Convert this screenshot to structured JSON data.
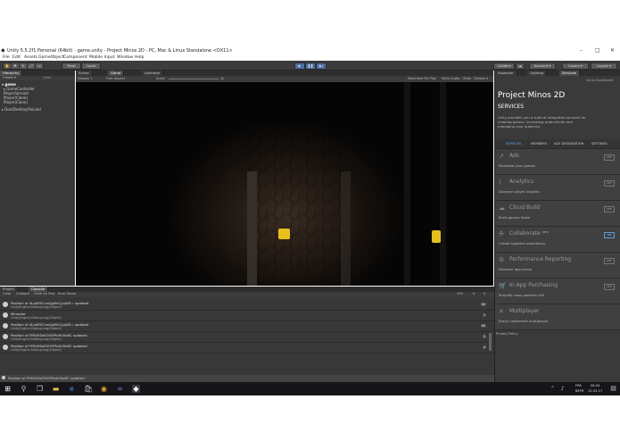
{
  "window": {
    "title": "Unity 5.5.2f1 Personal (64bit) - game.unity - Project Minos 2D - PC, Mac & Linux Standalone <DX11>",
    "minimize": "–",
    "maximize": "□",
    "close": "✕"
  },
  "menu": [
    "File",
    "Edit",
    "Assets",
    "GameObject",
    "Component",
    "Mobile Input",
    "Window",
    "Help"
  ],
  "toolbar": {
    "pivot": "Pivot",
    "local": "Local",
    "collab": "Collab ▾",
    "account": "Account ▾",
    "layers": "Layers ▾",
    "layout": "Layout ▾"
  },
  "hierarchy": {
    "tab": "Hierarchy",
    "create": "Create ▾",
    "search_placeholder": "Q▾All",
    "items": [
      "▾ game",
      "  ▸ GameController",
      "    PlayerServant",
      "    Player(Clone)",
      "    Player(Clone)",
      "▸ DontDestroyOnLoad"
    ]
  },
  "view_tabs": {
    "scene": "Scene",
    "game": "Game",
    "animator": "Animator"
  },
  "game_toolbar": {
    "display": "Display 1",
    "aspect": "Free Aspect",
    "scale_label": "Scale",
    "scale_value": "1x",
    "maximize": "Maximize On Play",
    "mute": "Mute Audio",
    "stats": "Stats",
    "gizmos": "Gizmos ▾"
  },
  "console": {
    "tab_project": "Project",
    "tab_console": "Console",
    "clear": "Clear",
    "collapse": "Collapse",
    "clear_on_play": "Clear on Play",
    "error_pause": "Error Pause",
    "counts": [
      "199",
      "0",
      "0"
    ],
    "rows": [
      {
        "line1": "Position of 4LpdR5CcwQgRhCjyqDE= updated",
        "line2": "UnityEngine.Debug:Log(Object)",
        "count": "64"
      },
      {
        "line1": "Minautor",
        "line2": "UnityEngine.Debug:Log(Object)",
        "count": "1"
      },
      {
        "line1": "Position of 4LpdR5CcwQgRhCjyqDE= updated",
        "line2": "UnityEngine.Debug:Log(Object)",
        "count": "65"
      },
      {
        "line1": "Position of FPAV9ZaE2H3PfuH05oRC updated",
        "line2": "UnityEngine.Debug:Log(Object)",
        "count": "5"
      },
      {
        "line1": "Position of FPAV9ZaE2H3PfuH05oRC updated",
        "line2": "UnityEngine.Debug:Log(Object)",
        "count": "4"
      }
    ],
    "status": "Position of FPAV9ZaE2H3PfuH05oRC updated"
  },
  "inspector_tabs": {
    "inspector": "Inspector",
    "lighting": "Lighting",
    "services": "Services"
  },
  "services": {
    "go_dashboard": "Go to Dashboard",
    "project_name": "Project Minos 2D",
    "section": "SERVICES",
    "description": "Unity provides you a suite of integrated services for creating games, increasing productivity and managing your audience",
    "nav": [
      "SERVICES",
      "MEMBERS",
      "AGE DESIGNATION",
      "SETTINGS"
    ],
    "items": [
      {
        "name": "Ads",
        "desc": "Monetize your games",
        "toggle": "OFF",
        "icon": "ads-icon",
        "glyph": "↗"
      },
      {
        "name": "Analytics",
        "desc": "Discover player insights",
        "toggle": "OFF",
        "icon": "analytics-icon",
        "glyph": "⌇"
      },
      {
        "name": "Cloud Build",
        "desc": "Build games faster",
        "toggle": "OFF",
        "icon": "cloud-build-icon",
        "glyph": "☁"
      },
      {
        "name": "Collaborate",
        "beta": "BETA",
        "desc": "Create together seamlessly",
        "toggle": "ON",
        "icon": "collaborate-icon",
        "glyph": "✣"
      },
      {
        "name": "Performance Reporting",
        "desc": "Discover app errors",
        "toggle": "OFF",
        "icon": "performance-icon",
        "glyph": "⚙"
      },
      {
        "name": "In-App Purchasing",
        "desc": "Simplify cross-platform IAP",
        "toggle": "OFF",
        "icon": "iap-icon",
        "glyph": "🛒"
      },
      {
        "name": "Multiplayer",
        "desc": "Easily implement multiplayer",
        "toggle": "",
        "icon": "multiplayer-icon",
        "glyph": "✕"
      }
    ],
    "privacy": "Privacy Policy"
  },
  "taskbar": {
    "lang": "FRA",
    "lang2": "BEFR",
    "time": "08:44",
    "date": "12-03-17"
  },
  "colors": {
    "accent": "#4a6fa5",
    "sprite": "#e8c018",
    "panel": "#383838"
  }
}
